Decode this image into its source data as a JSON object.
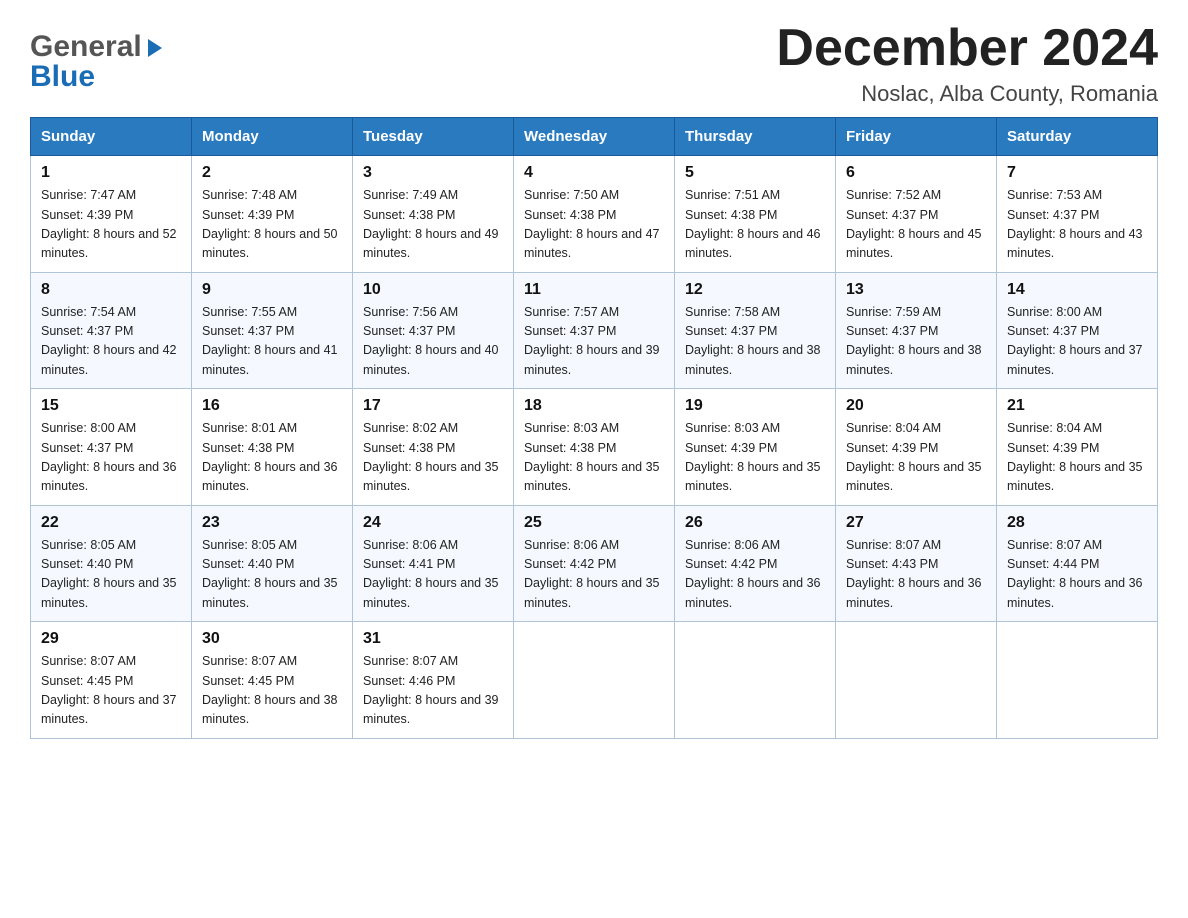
{
  "logo": {
    "line1": "General",
    "line2": "Blue"
  },
  "title": "December 2024",
  "subtitle": "Noslac, Alba County, Romania",
  "weekdays": [
    "Sunday",
    "Monday",
    "Tuesday",
    "Wednesday",
    "Thursday",
    "Friday",
    "Saturday"
  ],
  "weeks": [
    [
      {
        "day": "1",
        "sunrise": "7:47 AM",
        "sunset": "4:39 PM",
        "daylight": "8 hours and 52 minutes."
      },
      {
        "day": "2",
        "sunrise": "7:48 AM",
        "sunset": "4:39 PM",
        "daylight": "8 hours and 50 minutes."
      },
      {
        "day": "3",
        "sunrise": "7:49 AM",
        "sunset": "4:38 PM",
        "daylight": "8 hours and 49 minutes."
      },
      {
        "day": "4",
        "sunrise": "7:50 AM",
        "sunset": "4:38 PM",
        "daylight": "8 hours and 47 minutes."
      },
      {
        "day": "5",
        "sunrise": "7:51 AM",
        "sunset": "4:38 PM",
        "daylight": "8 hours and 46 minutes."
      },
      {
        "day": "6",
        "sunrise": "7:52 AM",
        "sunset": "4:37 PM",
        "daylight": "8 hours and 45 minutes."
      },
      {
        "day": "7",
        "sunrise": "7:53 AM",
        "sunset": "4:37 PM",
        "daylight": "8 hours and 43 minutes."
      }
    ],
    [
      {
        "day": "8",
        "sunrise": "7:54 AM",
        "sunset": "4:37 PM",
        "daylight": "8 hours and 42 minutes."
      },
      {
        "day": "9",
        "sunrise": "7:55 AM",
        "sunset": "4:37 PM",
        "daylight": "8 hours and 41 minutes."
      },
      {
        "day": "10",
        "sunrise": "7:56 AM",
        "sunset": "4:37 PM",
        "daylight": "8 hours and 40 minutes."
      },
      {
        "day": "11",
        "sunrise": "7:57 AM",
        "sunset": "4:37 PM",
        "daylight": "8 hours and 39 minutes."
      },
      {
        "day": "12",
        "sunrise": "7:58 AM",
        "sunset": "4:37 PM",
        "daylight": "8 hours and 38 minutes."
      },
      {
        "day": "13",
        "sunrise": "7:59 AM",
        "sunset": "4:37 PM",
        "daylight": "8 hours and 38 minutes."
      },
      {
        "day": "14",
        "sunrise": "8:00 AM",
        "sunset": "4:37 PM",
        "daylight": "8 hours and 37 minutes."
      }
    ],
    [
      {
        "day": "15",
        "sunrise": "8:00 AM",
        "sunset": "4:37 PM",
        "daylight": "8 hours and 36 minutes."
      },
      {
        "day": "16",
        "sunrise": "8:01 AM",
        "sunset": "4:38 PM",
        "daylight": "8 hours and 36 minutes."
      },
      {
        "day": "17",
        "sunrise": "8:02 AM",
        "sunset": "4:38 PM",
        "daylight": "8 hours and 35 minutes."
      },
      {
        "day": "18",
        "sunrise": "8:03 AM",
        "sunset": "4:38 PM",
        "daylight": "8 hours and 35 minutes."
      },
      {
        "day": "19",
        "sunrise": "8:03 AM",
        "sunset": "4:39 PM",
        "daylight": "8 hours and 35 minutes."
      },
      {
        "day": "20",
        "sunrise": "8:04 AM",
        "sunset": "4:39 PM",
        "daylight": "8 hours and 35 minutes."
      },
      {
        "day": "21",
        "sunrise": "8:04 AM",
        "sunset": "4:39 PM",
        "daylight": "8 hours and 35 minutes."
      }
    ],
    [
      {
        "day": "22",
        "sunrise": "8:05 AM",
        "sunset": "4:40 PM",
        "daylight": "8 hours and 35 minutes."
      },
      {
        "day": "23",
        "sunrise": "8:05 AM",
        "sunset": "4:40 PM",
        "daylight": "8 hours and 35 minutes."
      },
      {
        "day": "24",
        "sunrise": "8:06 AM",
        "sunset": "4:41 PM",
        "daylight": "8 hours and 35 minutes."
      },
      {
        "day": "25",
        "sunrise": "8:06 AM",
        "sunset": "4:42 PM",
        "daylight": "8 hours and 35 minutes."
      },
      {
        "day": "26",
        "sunrise": "8:06 AM",
        "sunset": "4:42 PM",
        "daylight": "8 hours and 36 minutes."
      },
      {
        "day": "27",
        "sunrise": "8:07 AM",
        "sunset": "4:43 PM",
        "daylight": "8 hours and 36 minutes."
      },
      {
        "day": "28",
        "sunrise": "8:07 AM",
        "sunset": "4:44 PM",
        "daylight": "8 hours and 36 minutes."
      }
    ],
    [
      {
        "day": "29",
        "sunrise": "8:07 AM",
        "sunset": "4:45 PM",
        "daylight": "8 hours and 37 minutes."
      },
      {
        "day": "30",
        "sunrise": "8:07 AM",
        "sunset": "4:45 PM",
        "daylight": "8 hours and 38 minutes."
      },
      {
        "day": "31",
        "sunrise": "8:07 AM",
        "sunset": "4:46 PM",
        "daylight": "8 hours and 39 minutes."
      },
      null,
      null,
      null,
      null
    ]
  ]
}
